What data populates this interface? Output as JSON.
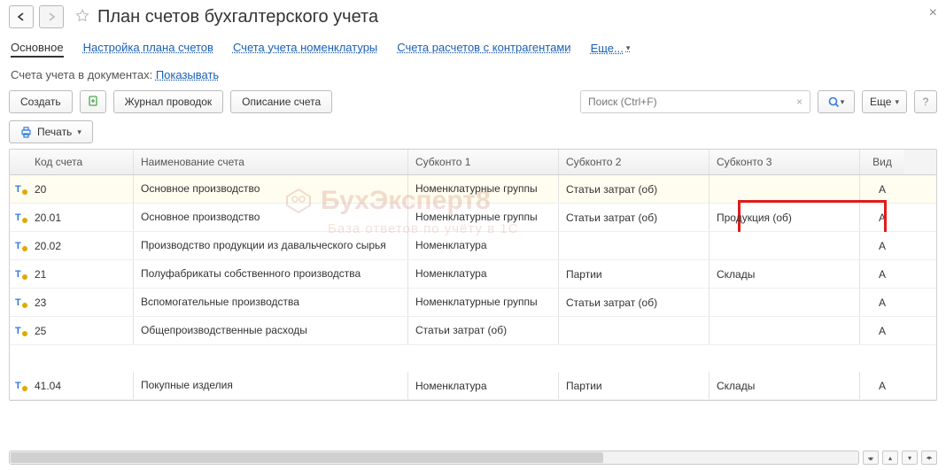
{
  "header": {
    "title": "План счетов бухгалтерского учета"
  },
  "tabs": {
    "main": "Основное",
    "config": "Настройка плана счетов",
    "nomen": "Счета учета номенклатуры",
    "contr": "Счета расчетов с контрагентами",
    "more": "Еще..."
  },
  "subline": {
    "label": "Счета учета в документах:",
    "link": "Показывать"
  },
  "toolbar": {
    "create": "Создать",
    "journal": "Журнал проводок",
    "describe": "Описание счета",
    "search_placeholder": "Поиск (Ctrl+F)",
    "more": "Еще",
    "help": "?",
    "print": "Печать"
  },
  "columns": {
    "code": "Код счета",
    "name": "Наименование счета",
    "s1": "Субконто 1",
    "s2": "Субконто 2",
    "s3": "Субконто 3",
    "vid": "Вид"
  },
  "rows": [
    {
      "code": "20",
      "name": "Основное производство",
      "s1": "Номенклатурные группы",
      "s2": "Статьи затрат (об)",
      "s3": "",
      "vid": "А",
      "hl": true
    },
    {
      "code": "20.01",
      "name": "Основное производство",
      "s1": "Номенклатурные группы",
      "s2": "Статьи затрат (об)",
      "s3": "Продукция (об)",
      "vid": "А",
      "redbox": true
    },
    {
      "code": "20.02",
      "name": "Производство продукции из давальческого сырья",
      "s1": "Номенклатура",
      "s2": "",
      "s3": "",
      "vid": "А"
    },
    {
      "code": "21",
      "name": "Полуфабрикаты собственного производства",
      "s1": "Номенклатура",
      "s2": "Партии",
      "s3": "Склады",
      "vid": "А"
    },
    {
      "code": "23",
      "name": "Вспомогательные производства",
      "s1": "Номенклатурные группы",
      "s2": "Статьи затрат (об)",
      "s3": "",
      "vid": "А"
    },
    {
      "code": "25",
      "name": "Общепроизводственные расходы",
      "s1": "Статьи затрат (об)",
      "s2": "",
      "s3": "",
      "vid": "А"
    }
  ],
  "extra_row": {
    "code": "41.04",
    "name": "Покупные изделия",
    "s1": "Номенклатура",
    "s2": "Партии",
    "s3": "Склады",
    "vid": "А"
  },
  "watermark": {
    "main": "БухЭксперт8",
    "sub": "База ответов по учёту в 1С"
  }
}
